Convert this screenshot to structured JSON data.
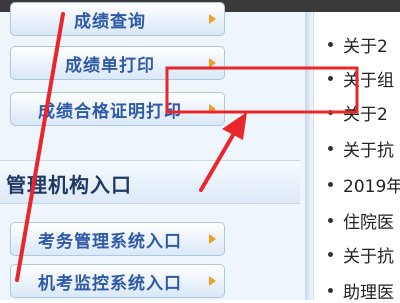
{
  "left_menu": {
    "buttons": [
      {
        "label": "成绩查询"
      },
      {
        "label": "成绩单打印"
      },
      {
        "label": "成绩合格证明打印"
      }
    ],
    "section_title": "管理机构入口",
    "entries": [
      {
        "label": "考务管理系统入口"
      },
      {
        "label": "机考监控系统入口"
      }
    ]
  },
  "news_list": {
    "items": [
      {
        "text": "关于2"
      },
      {
        "text": "关于组"
      },
      {
        "text": "关于2"
      },
      {
        "text": "关于抗"
      },
      {
        "text": "2019年"
      },
      {
        "text": "住院医"
      },
      {
        "text": "关于抗"
      },
      {
        "text": "助理医"
      }
    ]
  },
  "annotation": {
    "color": "#e8262b"
  }
}
